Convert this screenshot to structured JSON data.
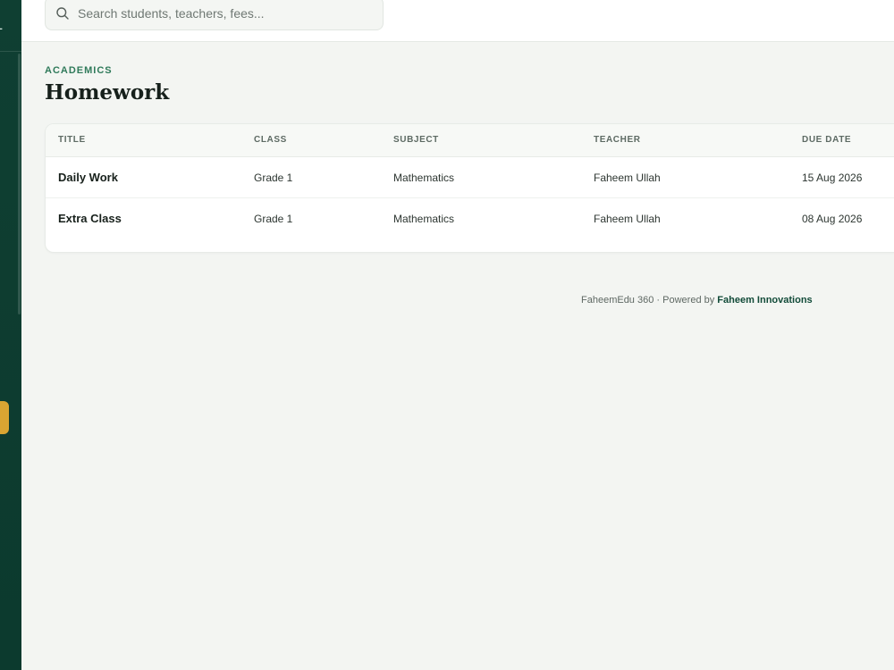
{
  "sidebar": {
    "brand_fragment": "L"
  },
  "search": {
    "placeholder": "Search students, teachers, fees..."
  },
  "header": {
    "section": "ACADEMICS",
    "title": "Homework"
  },
  "table": {
    "columns": [
      "TITLE",
      "CLASS",
      "SUBJECT",
      "TEACHER",
      "DUE DATE"
    ],
    "rows": [
      {
        "title": "Daily Work",
        "class": "Grade 1",
        "subject": "Mathematics",
        "teacher": "Faheem Ullah",
        "due": "15 Aug 2026"
      },
      {
        "title": "Extra Class",
        "class": "Grade 1",
        "subject": "Mathematics",
        "teacher": "Faheem Ullah",
        "due": "08 Aug 2026"
      }
    ]
  },
  "footer": {
    "product": "FaheemEdu 360",
    "separator": "·",
    "powered_by": "Powered by",
    "company": "Faheem Innovations"
  },
  "colors": {
    "sidebar": "#0f3f32",
    "accent": "#2f7a5a",
    "active_marker": "#d9a532",
    "background": "#f3f5f2"
  },
  "icons": {
    "search": "search-icon"
  }
}
